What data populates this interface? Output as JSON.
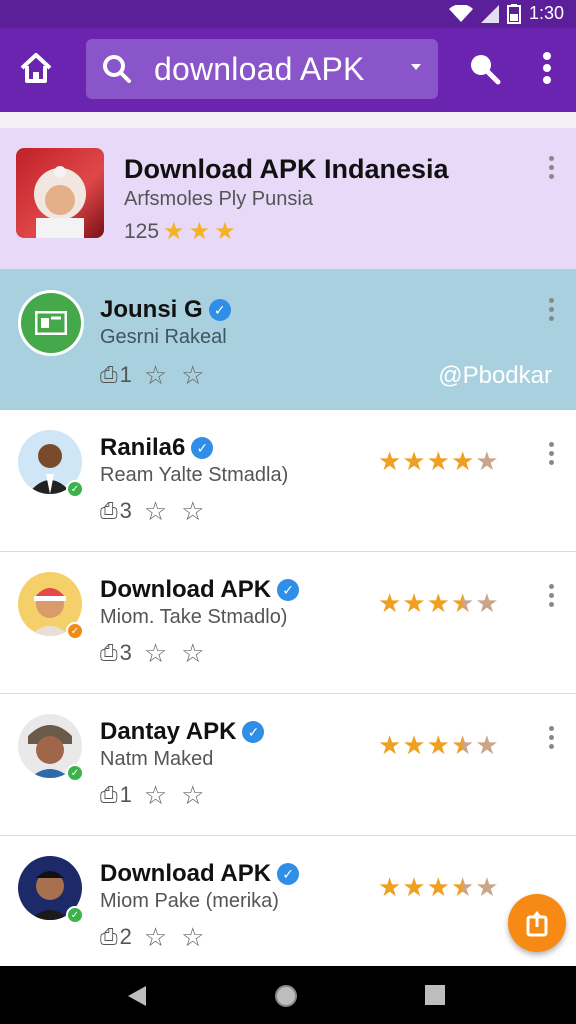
{
  "status_bar": {
    "time": "1:30",
    "icons": [
      "wifi-icon",
      "signal-icon",
      "battery-icon"
    ]
  },
  "app_bar": {
    "search_query": "download APK",
    "icons": [
      "home-icon",
      "search-icon",
      "chevron-down-icon",
      "search-icon",
      "more-vert-icon"
    ]
  },
  "featured": {
    "title": "Download APK Indanesia",
    "subtitle": "Arfsmoles Ply Punsia",
    "count": "125",
    "stars": 3
  },
  "highlight": {
    "title": "Jounsi G",
    "subtitle": "Gesrni Rakeal",
    "share_count": "1",
    "watermark": "@Pbodkar"
  },
  "items": [
    {
      "title": "Ranila6",
      "subtitle": "Ream Yalte Stmadla)",
      "share_count": "3",
      "rating": 4,
      "badge_color": "#3bb34a"
    },
    {
      "title": "Download APK",
      "subtitle": "Miom. Take Stmadlo)",
      "share_count": "3",
      "rating": 3.5,
      "badge_color": "#f08a18"
    },
    {
      "title": "Dantay APK",
      "subtitle": "Natm Maked",
      "share_count": "1",
      "rating": 3.5,
      "badge_color": "#3bb34a"
    },
    {
      "title": "Download APK",
      "subtitle": "Miom Pake (merika)",
      "share_count": "2",
      "rating": 3.5,
      "badge_color": "#3bb34a"
    }
  ],
  "colors": {
    "app_bar": "#6a24b0",
    "featured_bg": "#e7d9f7",
    "highlight_bg": "#a9d0de",
    "fab": "#f78a14",
    "star": "#f0a020"
  }
}
